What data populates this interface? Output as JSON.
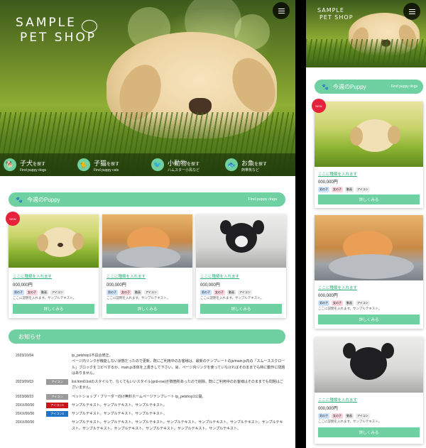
{
  "logo": {
    "line1": "SAMPLE",
    "line2": "PET SHOP"
  },
  "categories": [
    {
      "title": "子犬",
      "suffix": "を探す",
      "sub": "Find puppy dogs",
      "icon": "dog-icon"
    },
    {
      "title": "子猫",
      "suffix": "を探す",
      "sub": "Find puppy cats",
      "icon": "cat-icon"
    },
    {
      "title": "小動物",
      "suffix": "を探す",
      "sub": "ハムスター小鳥など",
      "icon": "bird-icon"
    },
    {
      "title": "お魚",
      "suffix": "を探す",
      "sub": "熱帯魚など",
      "icon": "fish-icon"
    }
  ],
  "section_puppy": {
    "title": "今週のPuppy",
    "sub": "Find puppy dogs"
  },
  "section_news": {
    "title": "お知らせ"
  },
  "new_badge": "NEW",
  "cards": [
    {
      "link": "ここに種類を入れます",
      "price": "000,000円",
      "tags": [
        "男の子",
        "女の子",
        "動画",
        "アイコン"
      ],
      "desc": "ここに説明を入れます。サンプルテキスト。",
      "button": "詳しくみる"
    },
    {
      "link": "ここに種類を入れます",
      "price": "000,000円",
      "tags": [
        "男の子",
        "女の子",
        "動画",
        "アイコン"
      ],
      "desc": "ここに説明を入れます。サンプルテキスト。",
      "button": "詳しくみる"
    },
    {
      "link": "ここに種類を入れます",
      "price": "000,000円",
      "tags": [
        "男の子",
        "女の子",
        "動画",
        "アイコン"
      ],
      "desc": "ここに説明を入れます。サンプルテキスト。",
      "button": "詳しくみる"
    }
  ],
  "news": [
    {
      "date": "2023/10/04",
      "badge": "",
      "text": "tp_petshop1不具合修正。\nページ内リンクが機能しない状態だったので更新。既にご利用中のお客様は、最新のテンプレートのjs/main.js内の「スムーススクロール」ブロックをコピペするか、main.js本体を上書きして下さい。尚、ページ内リンクを使っていなければそのままでも特に動作に問題はありません。"
    },
    {
      "date": "2023/09/03",
      "badge": "アイコン",
      "text": "list.html0.listのスタイルで、なくてもいいスタイル(grid-row)が数箇所あったので削除。既にご利用中のお客様はそのままでも問題はございません。"
    },
    {
      "date": "2023/08/23",
      "badge": "アイコン",
      "text": "ペットショップ・ブリーダー向け無料ホームページテンプレート tp_petshop1公開。"
    },
    {
      "date": "20XX/00/00",
      "badge": "アイコン1",
      "text": "サンプルテキスト。サンプルテキスト。サンプルテキスト。"
    },
    {
      "date": "20XX/00/00",
      "badge": "アイコン2",
      "text": "サンプルテキスト。サンプルテキスト。サンプルテキスト。"
    },
    {
      "date": "20XX/00/00",
      "badge": "",
      "text": "サンプルテキスト。サンプルテキスト。サンプルテキスト。サンプルテキスト。サンプルテキスト。サンプルテキスト。サンプルテキスト。サンプルテキスト。サンプルテキスト。サンプルテキスト。サンプルテキスト。サンプルテキスト。"
    }
  ],
  "colors": {
    "accent": "#6fd0a1",
    "new_badge": "#e5213b",
    "link": "#2fb07b"
  }
}
